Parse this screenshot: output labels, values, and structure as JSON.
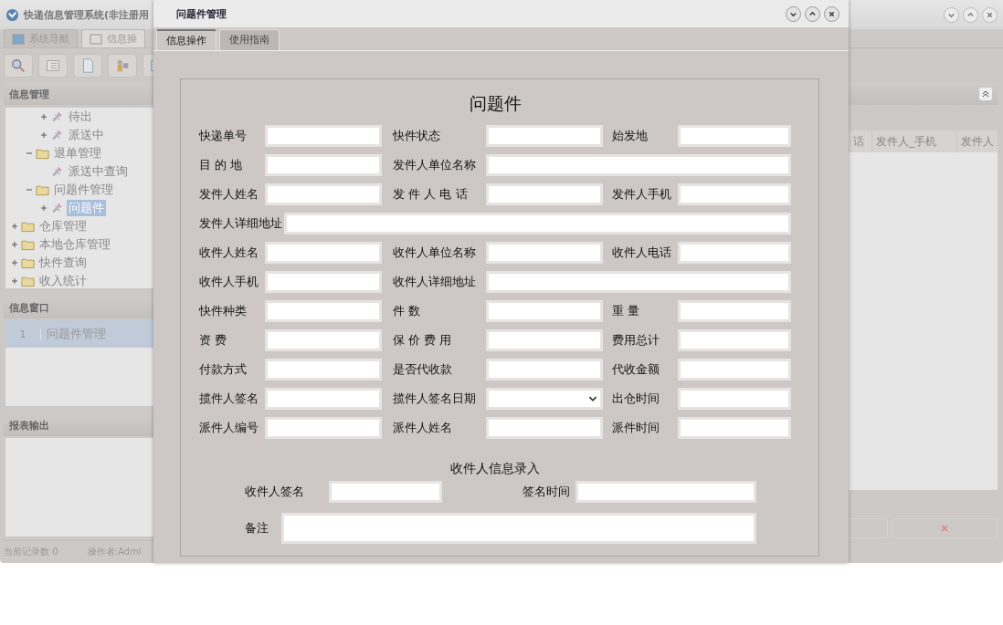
{
  "app": {
    "title": "快递信息管理系统(非注册用",
    "tabs": [
      {
        "label": "系统导航",
        "selected": false
      },
      {
        "label": "信息操",
        "selected": true
      }
    ],
    "nav_panel": {
      "title": "信息管理",
      "tree": [
        {
          "children": [
            {
              "children": [
                {
                  "label": "待出",
                  "kind": "task",
                  "expanded": false,
                  "selected": false
                },
                {
                  "label": "派送中",
                  "kind": "task",
                  "expanded": false,
                  "selected": false
                }
              ]
            },
            {
              "label": "退单管理",
              "kind": "folder",
              "expanded": true,
              "selected": false,
              "children": [
                {
                  "label": "派送中查询",
                  "kind": "task",
                  "selected": false
                }
              ]
            },
            {
              "label": "问题件管理",
              "kind": "folder",
              "expanded": true,
              "selected": false,
              "children": [
                {
                  "label": "问题件",
                  "kind": "task",
                  "expanded": false,
                  "selected": true
                }
              ]
            }
          ]
        },
        {
          "label": "仓库管理",
          "kind": "folder",
          "expanded": false,
          "selected": false
        },
        {
          "label": "本地仓库管理",
          "kind": "folder",
          "expanded": false,
          "selected": false
        },
        {
          "label": "快件查询",
          "kind": "folder",
          "expanded": false,
          "selected": false
        },
        {
          "label": "收入统计",
          "kind": "folder",
          "expanded": false,
          "selected": false
        }
      ]
    },
    "window_panel": {
      "title": "信息窗口",
      "rows": [
        {
          "index": "1",
          "name": "问题件管理",
          "selected": true
        }
      ]
    },
    "report_panel": {
      "title": "报表输出"
    },
    "status_bar": {
      "record_count": "当前记录数 0",
      "operator": "操作者:Admi"
    },
    "table": {
      "columns": [
        "话",
        "发件人_手机",
        "发件人"
      ]
    }
  },
  "dialog": {
    "title": "问题件管理",
    "tabs": [
      {
        "label": "信息操作",
        "selected": true
      },
      {
        "label": "使用指南",
        "selected": false
      }
    ],
    "form_title": "问题件",
    "rows": [
      [
        {
          "label": "快递单号",
          "kind": "text"
        },
        {
          "label": "快件状态",
          "kind": "text"
        },
        {
          "label": "始发地",
          "kind": "text"
        }
      ],
      [
        {
          "label": "目 的 地",
          "kind": "text"
        },
        {
          "label": "发件人单位名称",
          "kind": "text"
        }
      ],
      [
        {
          "label": "发件人姓名",
          "kind": "text"
        },
        {
          "label": "发 件 人 电 话",
          "kind": "text"
        },
        {
          "label": "发件人手机",
          "kind": "text"
        }
      ],
      [
        {
          "label": "发件人详细地址",
          "kind": "text"
        }
      ],
      [
        {
          "label": "收件人姓名",
          "kind": "text"
        },
        {
          "label": "收件人单位名称",
          "kind": "text"
        },
        {
          "label": "收件人电话",
          "kind": "text"
        }
      ],
      [
        {
          "label": "收件人手机",
          "kind": "text"
        },
        {
          "label": "收件人详细地址",
          "kind": "text"
        }
      ],
      [
        {
          "label": "快件种类",
          "kind": "text"
        },
        {
          "label": "件 数",
          "kind": "text"
        },
        {
          "label": "重 量",
          "kind": "text"
        }
      ],
      [
        {
          "label": "资 费",
          "kind": "text"
        },
        {
          "label": "保 价 费 用",
          "kind": "text"
        },
        {
          "label": "费用总计",
          "kind": "text"
        }
      ],
      [
        {
          "label": "付款方式",
          "kind": "text"
        },
        {
          "label": "是否代收款",
          "kind": "text"
        },
        {
          "label": "代收金额",
          "kind": "text"
        }
      ],
      [
        {
          "label": "揽件人签名",
          "kind": "text"
        },
        {
          "label": "揽件人签名日期",
          "kind": "select"
        },
        {
          "label": "出仓时间",
          "kind": "text"
        }
      ],
      [
        {
          "label": "派件人编号",
          "kind": "text"
        },
        {
          "label": "派件人姓名",
          "kind": "text"
        },
        {
          "label": "派件时间",
          "kind": "text"
        }
      ]
    ],
    "section_title": "收件人信息录入",
    "receiver_fields": [
      {
        "label": "收件人签名",
        "kind": "text"
      },
      {
        "label": "签名时间",
        "kind": "text"
      }
    ],
    "note": {
      "label": "备注"
    }
  }
}
